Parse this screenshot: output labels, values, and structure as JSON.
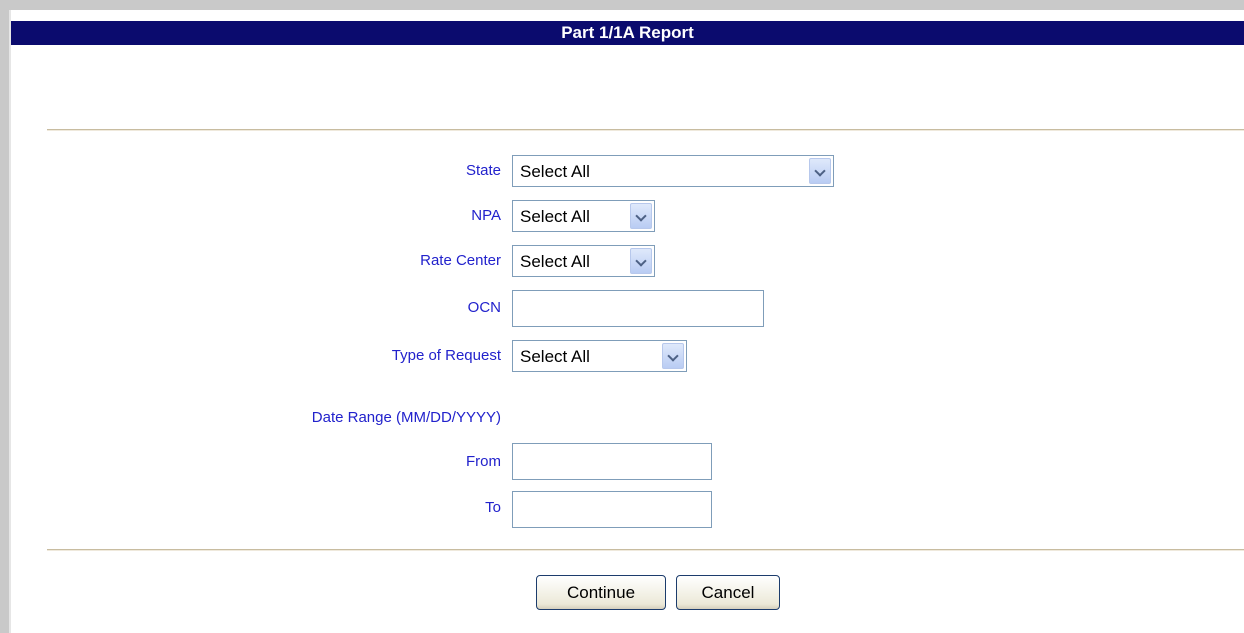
{
  "page": {
    "title": "Part 1/1A Report"
  },
  "form": {
    "state": {
      "label": "State",
      "selected": "Select All"
    },
    "npa": {
      "label": "NPA",
      "selected": "Select All"
    },
    "rate_center": {
      "label": "Rate Center",
      "selected": "Select All"
    },
    "ocn": {
      "label": "OCN",
      "value": ""
    },
    "type_of_request": {
      "label": "Type of Request",
      "selected": "Select All"
    },
    "date_range": {
      "heading": "Date Range (MM/DD/YYYY)",
      "from": {
        "label": "From",
        "value": ""
      },
      "to": {
        "label": "To",
        "value": ""
      }
    }
  },
  "actions": {
    "continue_label": "Continue",
    "cancel_label": "Cancel"
  },
  "colors": {
    "title_bar": "#0b0b6e",
    "label_text": "#2222cc",
    "field_border": "#7f9db9"
  }
}
